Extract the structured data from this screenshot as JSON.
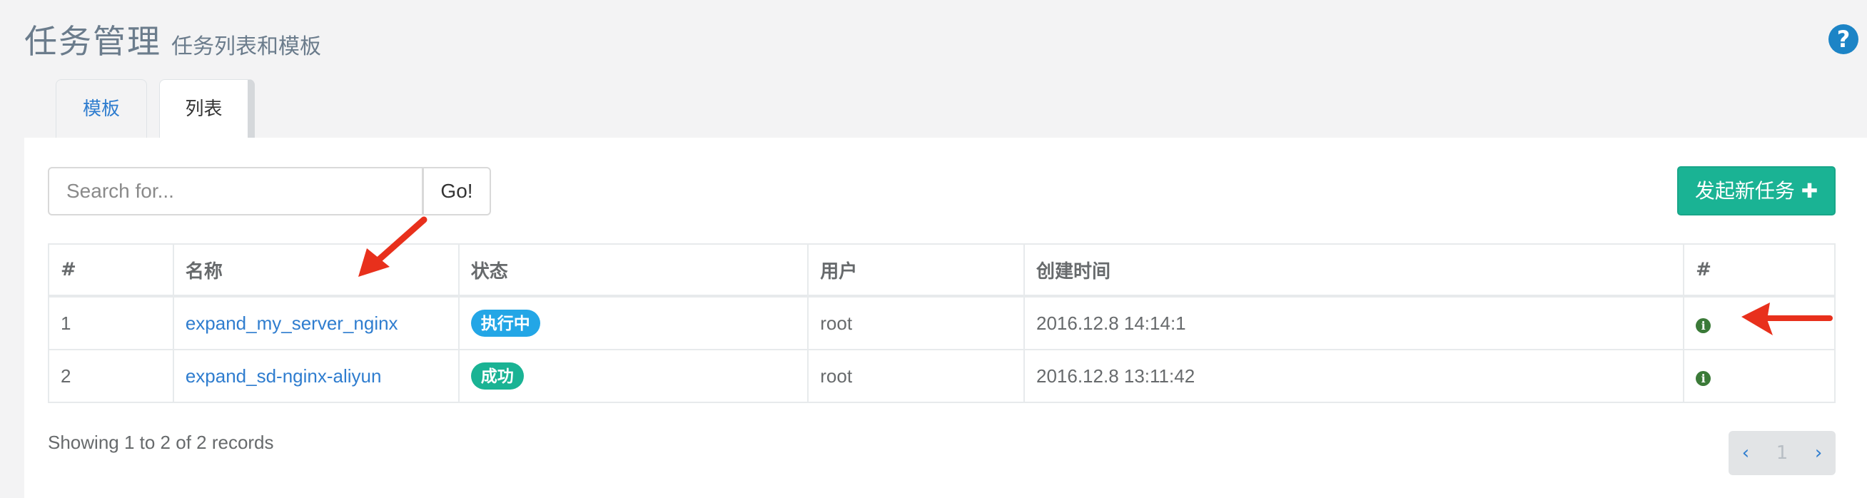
{
  "header": {
    "title": "任务管理",
    "subtitle": "任务列表和模板",
    "help_icon": "?"
  },
  "tabs": [
    {
      "label": "模板",
      "active": false
    },
    {
      "label": "列表",
      "active": true
    }
  ],
  "toolbar": {
    "search_placeholder": "Search for...",
    "go_label": "Go!",
    "new_task_label": "发起新任务 ✚"
  },
  "table": {
    "columns": [
      "#",
      "名称",
      "状态",
      "用户",
      "创建时间",
      "#"
    ],
    "rows": [
      {
        "id": "1",
        "name": "expand_my_server_nginx",
        "status": "执行中",
        "status_color": "#23a6e6",
        "user": "root",
        "created": "2016.12.8 14:14:1",
        "action_icon": "i"
      },
      {
        "id": "2",
        "name": "expand_sd-nginx-aliyun",
        "status": "成功",
        "status_color": "#1ab394",
        "user": "root",
        "created": "2016.12.8 13:11:42",
        "action_icon": "i"
      }
    ]
  },
  "footer": {
    "showing": "Showing 1 to 2 of 2 records"
  },
  "pagination": {
    "prev": "‹",
    "current": "1",
    "next": "›"
  },
  "colors": {
    "accent": "#1ab394",
    "link": "#2f7dcf",
    "annotation_arrow": "#e8301c"
  }
}
